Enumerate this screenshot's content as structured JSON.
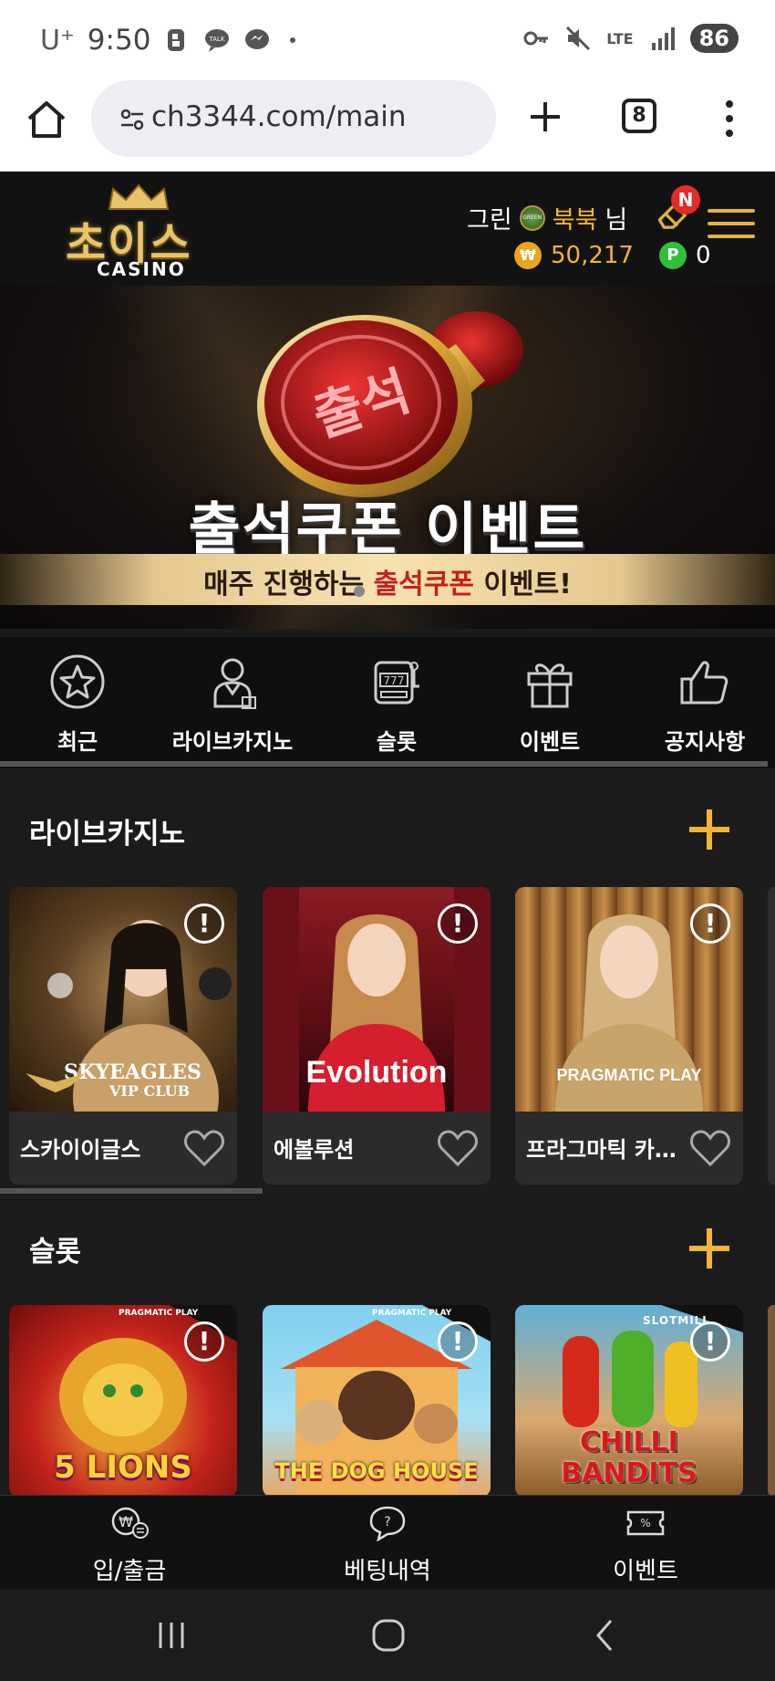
{
  "status_bar": {
    "carrier": "U⁺",
    "time": "9:50",
    "network": "LTE",
    "battery": "86"
  },
  "browser": {
    "url": "ch3344.com/main",
    "tab_count": "8"
  },
  "header": {
    "logo_text_kr": "초이스",
    "logo_text_en": "CASINO",
    "level_prefix": "그린",
    "level_badge": "GREEN",
    "user_name": "북북",
    "user_suffix": "님",
    "notification_badge": "N",
    "coin_symbol": "₩",
    "balance": "50,217",
    "point_symbol": "P",
    "points": "0"
  },
  "banner": {
    "title": "출석쿠폰 이벤트",
    "subtitle_pre": "매주 진행하는 ",
    "subtitle_highlight": "출석쿠폰",
    "subtitle_post": " 이벤트!",
    "stamp_text": "출석"
  },
  "category_nav": [
    {
      "label": "최근",
      "icon": "star-icon"
    },
    {
      "label": "라이브카지노",
      "icon": "dealer-icon"
    },
    {
      "label": "슬롯",
      "icon": "slot-machine-icon"
    },
    {
      "label": "이벤트",
      "icon": "gift-icon"
    },
    {
      "label": "공지사항",
      "icon": "thumbs-up-icon"
    }
  ],
  "live_casino": {
    "title": "라이브카지노",
    "cards": [
      {
        "name": "스카이이글스",
        "brand": "SKYEAGLES",
        "brand_sub": "VIP CLUB"
      },
      {
        "name": "에볼루션",
        "brand": "Evolution"
      },
      {
        "name": "프라그마틱 카지노",
        "brand": "PRAGMATIC PLAY"
      }
    ]
  },
  "slots": {
    "title": "슬롯",
    "cards": [
      {
        "tag": "PRAGMATIC PLAY",
        "game": "5 LIONS"
      },
      {
        "tag": "PRAGMATIC PLAY",
        "game": "THE DOG HOUSE"
      },
      {
        "tag": "SLOTMILL",
        "game": "CHILLI BANDITS"
      }
    ]
  },
  "bottom_nav": [
    {
      "label": "입/출금",
      "icon": "deposit-withdraw-icon"
    },
    {
      "label": "베팅내역",
      "icon": "betting-history-icon"
    },
    {
      "label": "이벤트",
      "icon": "event-ticket-icon"
    }
  ],
  "colors": {
    "accent": "#f0b533",
    "background": "#1b1b1b",
    "notification": "#e52a2a",
    "point_green": "#2fbf3a"
  }
}
